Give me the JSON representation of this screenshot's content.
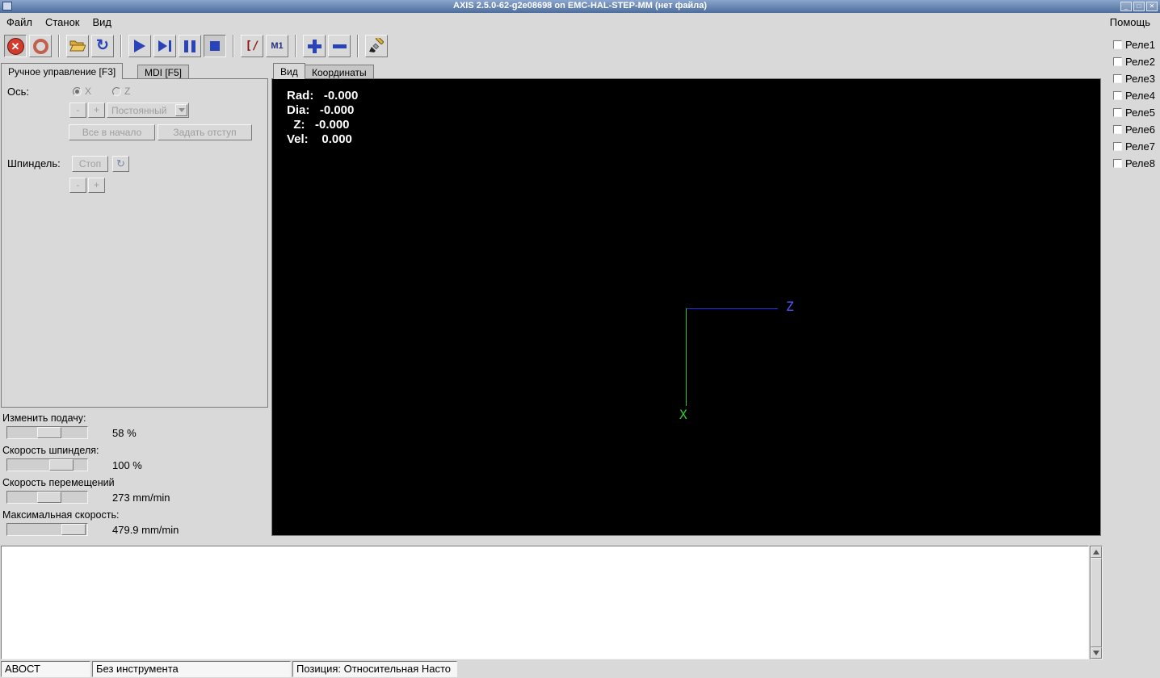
{
  "window": {
    "title": "AXIS 2.5.0-62-g2e08698 on EMC-HAL-STEP-MM (нет файла)"
  },
  "menubar": {
    "items": [
      "Файл",
      "Станок",
      "Вид"
    ],
    "help": "Помощь"
  },
  "toolbar": {
    "buttons": [
      "estop",
      "machine-power",
      "open-file",
      "reload",
      "run",
      "step",
      "pause",
      "stop",
      "block-delete",
      "optional-stop",
      "zoom-in",
      "zoom-out",
      "clear-plot"
    ],
    "block_delete_label": "[/",
    "optional_stop_label": "M1"
  },
  "relays": {
    "items": [
      "Реле1",
      "Реле2",
      "Реле3",
      "Реле4",
      "Реле5",
      "Реле6",
      "Реле7",
      "Реле8"
    ]
  },
  "left_panel": {
    "tabs": [
      {
        "label": "Ручное управление [F3]"
      },
      {
        "label": "MDI [F5]"
      }
    ],
    "axis_label": "Ось:",
    "axis_options": [
      "X",
      "Z"
    ],
    "jog_minus": "-",
    "jog_plus": "+",
    "jog_mode": "Постоянный",
    "home_all": "Все в начало",
    "touch_off": "Задать отступ",
    "spindle_label": "Шпиндель:",
    "spindle_stop": "Стоп",
    "spindle_minus": "-",
    "spindle_plus": "+"
  },
  "overrides": {
    "feed": {
      "label": "Изменить подачу:",
      "value": "58 %"
    },
    "spindle": {
      "label": "Скорость шпинделя:",
      "value": "100 %"
    },
    "jog": {
      "label": "Скорость перемещений",
      "value": "273 mm/min"
    },
    "max": {
      "label": "Максимальная скорость:",
      "value": "479.9 mm/min"
    }
  },
  "preview": {
    "tabs": [
      {
        "label": "Вид"
      },
      {
        "label": "Координаты"
      }
    ],
    "readout_lines": [
      "Rad:   -0.000",
      "Dia:   -0.000",
      "  Z:   -0.000",
      "Vel:    0.000"
    ],
    "axis_labels": {
      "z": "Z",
      "x": "X"
    },
    "colors": {
      "z_axis": "#2a2ae6",
      "x_axis": "#27c427",
      "readout": "#ffffff"
    }
  },
  "statusbar": {
    "cells": [
      "АВОСТ",
      "Без инструмента",
      "Позиция: Относительная Насто"
    ]
  }
}
